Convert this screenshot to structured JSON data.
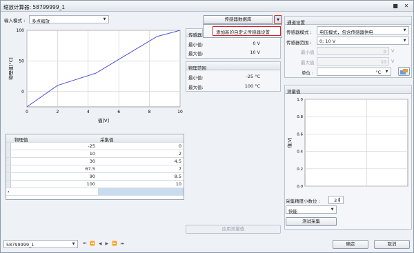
{
  "window": {
    "title": "缩放计算器: 58799999_1",
    "minimize_icon": "minimize-icon",
    "close_icon": "close-icon"
  },
  "left": {
    "input_mode_label": "输入模式 :",
    "input_mode_value": "多点缩放"
  },
  "chart_data": {
    "type": "line",
    "title": "",
    "xlabel": "值[V]",
    "ylabel": "物理值[°C]",
    "xlim": [
      0,
      10
    ],
    "ylim": [
      -25,
      100
    ],
    "xticks": [
      "0",
      "2",
      "4",
      "6",
      "8",
      "10"
    ],
    "yticks": [
      "100",
      "50",
      "0"
    ],
    "x": [
      0,
      2,
      4.5,
      7,
      8.5,
      10
    ],
    "y": [
      -25,
      10,
      30,
      67.5,
      90,
      100
    ],
    "color": "#4b4ddb",
    "grid": true
  },
  "sensor": {
    "db_button": "传感器数据库",
    "menu_item": "添加新的自定义传感器设置",
    "group_label": "传感器",
    "min_label": "最小值:",
    "min_value": "0 V",
    "max_label": "最大值:",
    "max_value": "10 V"
  },
  "physical": {
    "header": "物理范围",
    "min_label": "最小值:",
    "min_value": "-25 °C",
    "max_label": "最大值:",
    "max_value": "100 °C"
  },
  "table": {
    "col_physical": "物理值",
    "col_sample": "采集值",
    "rows": [
      {
        "physical": "-25",
        "sample": "0"
      },
      {
        "physical": "10",
        "sample": "2"
      },
      {
        "physical": "30",
        "sample": "4.5"
      },
      {
        "physical": "67.5",
        "sample": "7"
      },
      {
        "physical": "90",
        "sample": "8.5"
      },
      {
        "physical": "100",
        "sample": "10"
      }
    ],
    "new_row_marker": "›"
  },
  "apply_button": "应用测量值",
  "channel": {
    "header": "通道设置",
    "mode_label": "传感器模式 :",
    "mode_value": "电压模式，包含传感器供电",
    "range_label": "传感器范围 :",
    "range_value": "0; 10 V",
    "min_label": "最小值",
    "min_value": "0",
    "min_unit": "V",
    "max_label": "最大值",
    "max_value": "10",
    "max_unit": "V",
    "unit_label": "单位 :",
    "unit_value": "°C"
  },
  "measure": {
    "header": "测量值",
    "ylabel": "值[V]",
    "yticks": [
      "1.0",
      "0.8",
      "0.6",
      "0.4",
      "0.2",
      "0.0"
    ],
    "precision_label": "采集精度小数位 :",
    "precision_value": "3",
    "speed_value": "快能",
    "test_button": "测试采集"
  },
  "footer": {
    "record_value": "58799999_1",
    "ok_button": "确定",
    "cancel_button": "取消"
  }
}
